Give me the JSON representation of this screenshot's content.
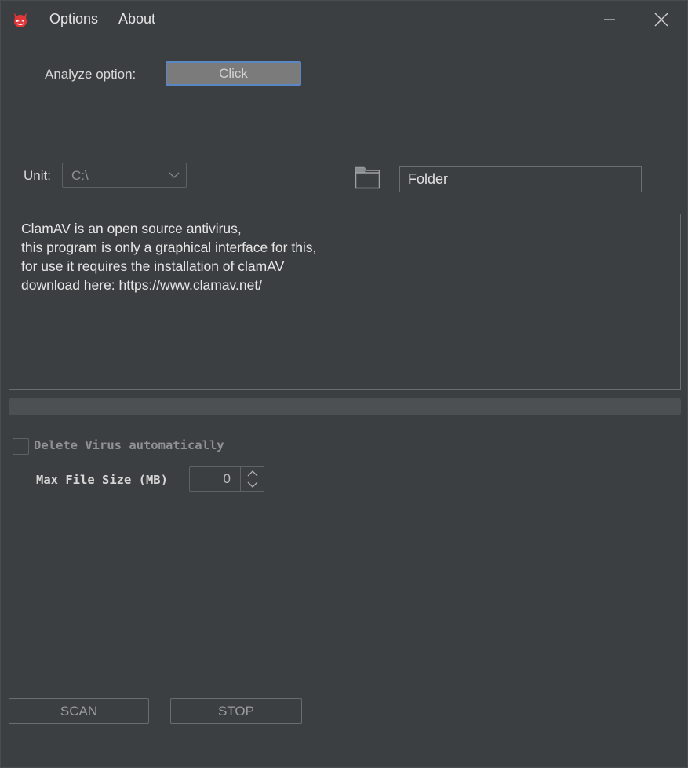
{
  "menu": {
    "options": "Options",
    "about": "About"
  },
  "window": {
    "app_icon": "red-devil-icon",
    "minimize_icon": "minimize-icon",
    "close_icon": "close-icon"
  },
  "analyze": {
    "label": "Analyze option:",
    "button": "Click"
  },
  "unit": {
    "label": "Unit:",
    "selected": "C:\\"
  },
  "folder": {
    "icon": "folder-icon",
    "value": "Folder"
  },
  "info_text": [
    "ClamAV is an open source antivirus,",
    "this program is only a graphical interface for this,",
    "for use it requires the installation of clamAV",
    "download here: https://www.clamav.net/"
  ],
  "progress": {
    "percent": 0
  },
  "options": {
    "delete_virus_label": "Delete Virus automatically",
    "delete_virus_checked": false,
    "max_file_size_label": "Max File Size (MB)",
    "max_file_size_value": "0"
  },
  "actions": {
    "scan": "SCAN",
    "stop": "STOP"
  },
  "colors": {
    "background": "#3c3f41",
    "accent": "#5a86c4",
    "app_icon": "#e0373a"
  }
}
